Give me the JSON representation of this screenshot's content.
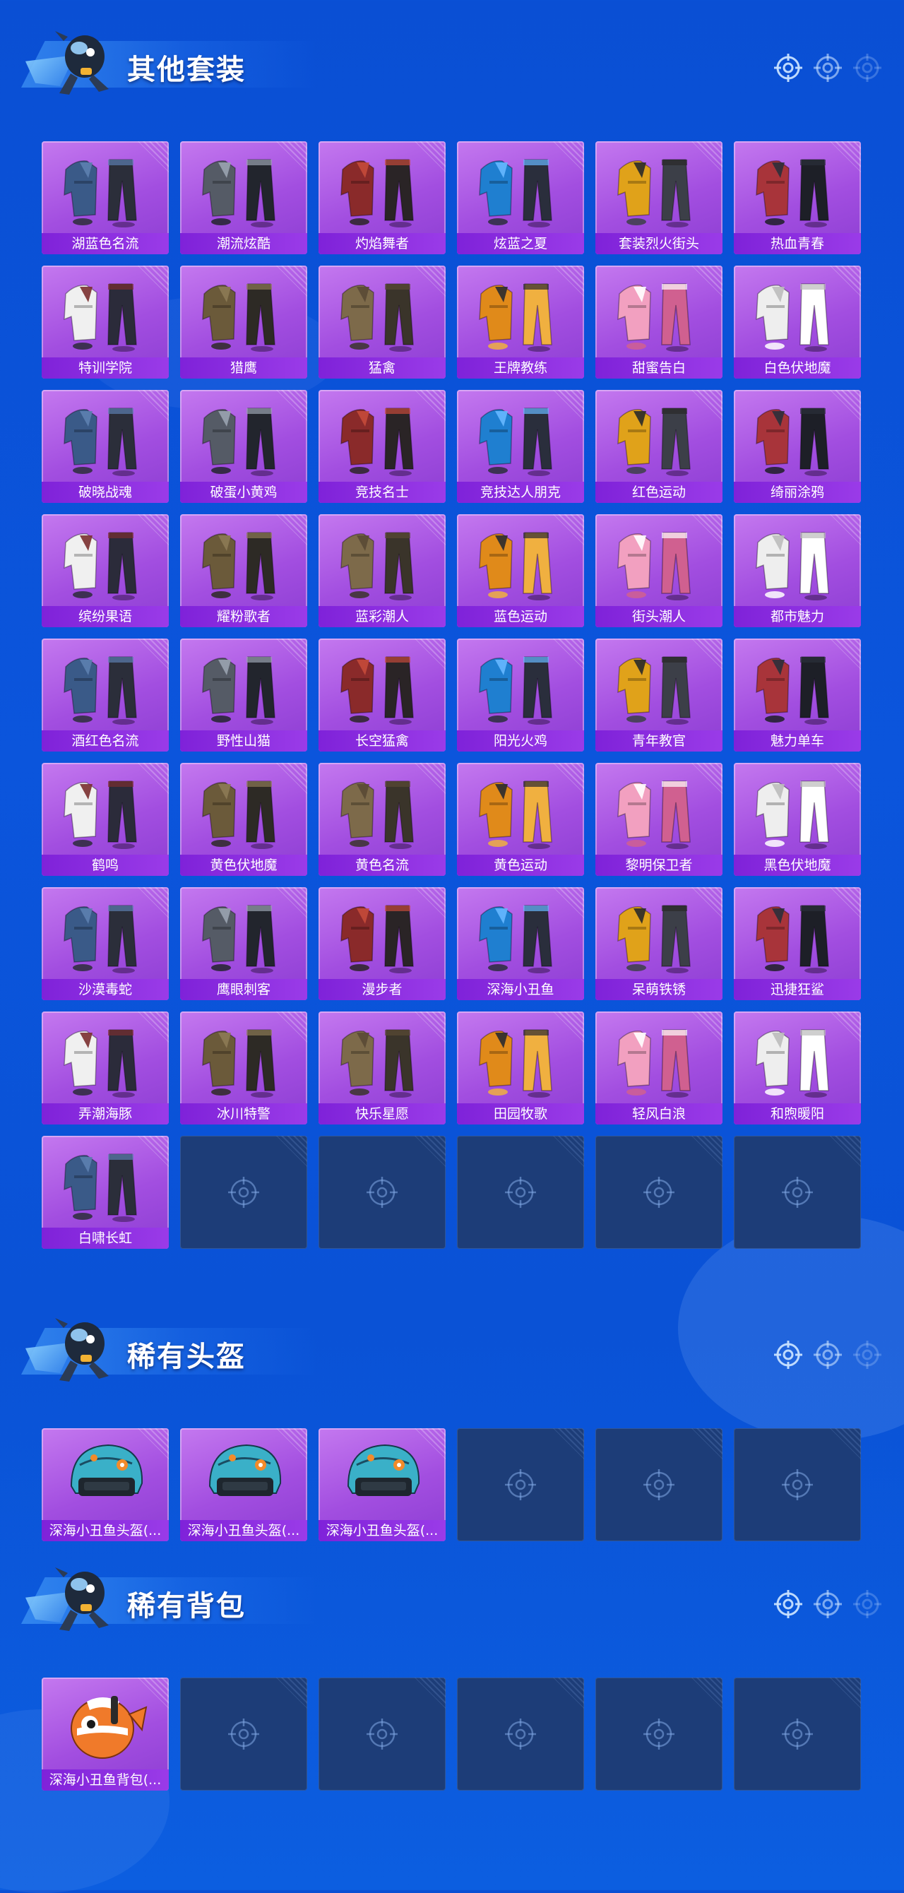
{
  "sections": [
    {
      "title": "其他套装",
      "items": [
        "湖蓝色名流",
        "潮流炫酷",
        "灼焰舞者",
        "炫蓝之夏",
        "套装烈火街头",
        "热血青春",
        "特训学院",
        "猎鹰",
        "猛禽",
        "王牌教练",
        "甜蜜告白",
        "白色伏地魔",
        "破晓战魂",
        "破蛋小黄鸡",
        "竞技名士",
        "竞技达人朋克",
        "红色运动",
        "绮丽涂鸦",
        "缤纷果语",
        "耀粉歌者",
        "蓝彩潮人",
        "蓝色运动",
        "街头潮人",
        "都市魅力",
        "酒红色名流",
        "野性山猫",
        "长空猛禽",
        "阳光火鸡",
        "青年教官",
        "魅力单车",
        "鹤鸣",
        "黄色伏地魔",
        "黄色名流",
        "黄色运动",
        "黎明保卫者",
        "黑色伏地魔",
        "沙漠毒蛇",
        "鹰眼刺客",
        "漫步者",
        "深海小丑鱼",
        "呆萌铁锈",
        "迅捷狂鲨",
        "弄潮海豚",
        "冰川特警",
        "快乐星愿",
        "田园牧歌",
        "轻风白浪",
        "和煦暖阳",
        "白啸长虹",
        "",
        "",
        "",
        "",
        ""
      ]
    },
    {
      "title": "稀有头盔",
      "items": [
        "深海小丑鱼头盔(...",
        "深海小丑鱼头盔(...",
        "深海小丑鱼头盔(...",
        "",
        "",
        ""
      ]
    },
    {
      "title": "稀有背包",
      "items": [
        "深海小丑鱼背包(...",
        "",
        "",
        "",
        "",
        ""
      ]
    }
  ],
  "colors": {
    "background": "#0a4fd4",
    "card_purple": "#a24ee0",
    "label_purple": "#7f22d9",
    "empty_slot": "#1d3d78"
  },
  "icons": {
    "header_mascot": "skydiver-chicken-icon",
    "header_marks": "crosshair-icon",
    "empty_slot": "crosshair-icon"
  }
}
